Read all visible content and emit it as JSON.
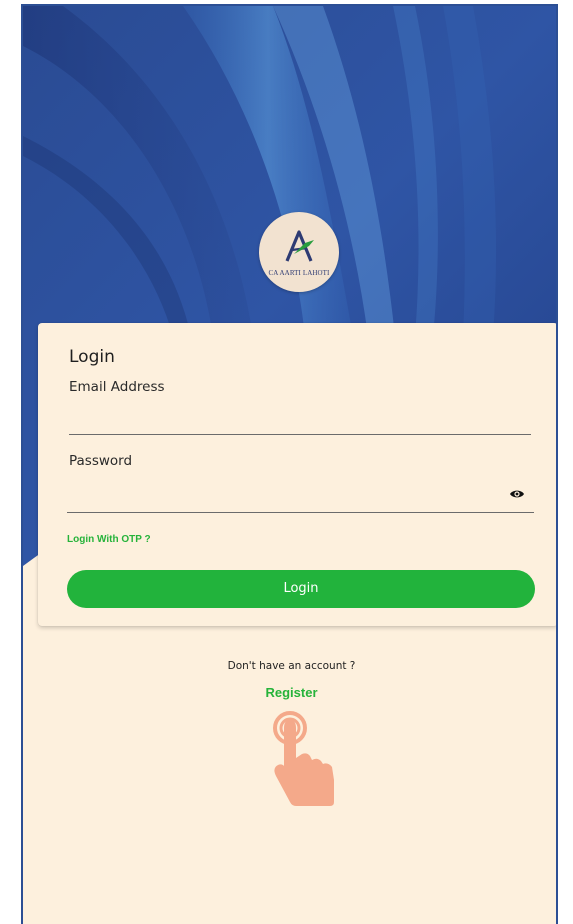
{
  "logo": {
    "text": "CA AARTI LAHOTI",
    "icon": "letter-a-logo-icon"
  },
  "login_card": {
    "title": "Login",
    "email_label": "Email Address",
    "email_value": "",
    "password_label": "Password",
    "password_value": "",
    "password_toggle_icon": "eye-icon",
    "otp_link": "Login With OTP ?",
    "login_button": "Login"
  },
  "footer": {
    "no_account_text": "Don't have an account ?",
    "register_link": "Register",
    "pointer_icon": "tapping-hand-icon"
  },
  "colors": {
    "background": "#fdf0dd",
    "hero_blue": "#2e4f9a",
    "accent_green": "#22b33c",
    "hand_skin": "#f4a98a"
  }
}
